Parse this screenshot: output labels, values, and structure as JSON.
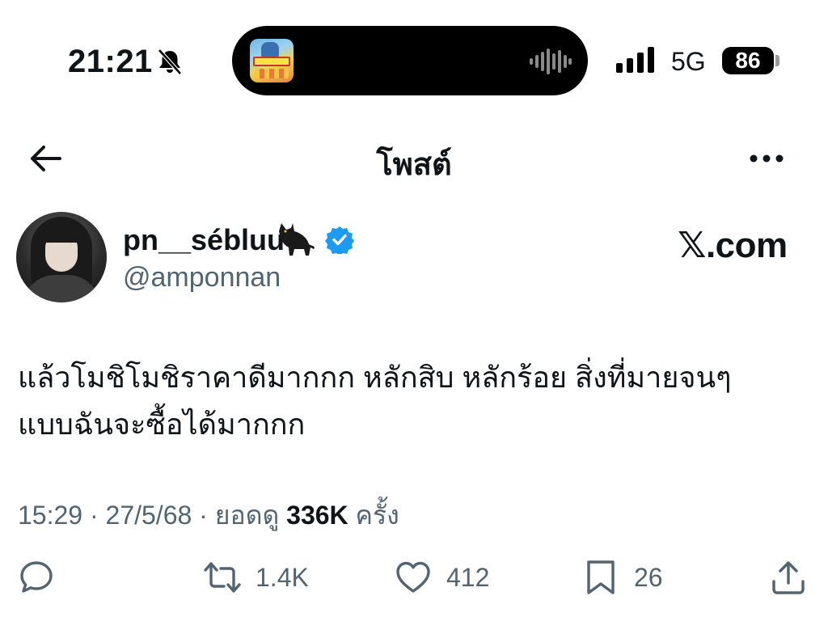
{
  "status_bar": {
    "time": "21:21",
    "network": "5G",
    "battery": "86"
  },
  "header": {
    "title": "โพสต์"
  },
  "author": {
    "display_name": "pn__sébluu",
    "handle": "@amponnan",
    "badge_icon": "verified-badge-icon",
    "badge_color": "#1d9bf0"
  },
  "watermark": "𝕏.com",
  "tweet": {
    "text": "แล้วโมชิโมชิราคาดีมากกก หลักสิบ หลักร้อย สิ่งที่มายจนๆ\nแบบฉันจะซื้อได้มากกก"
  },
  "meta": {
    "time": "15:29",
    "date": "27/5/68",
    "views_label": "ยอดดู",
    "views_count": "336K",
    "views_suffix": "ครั้ง"
  },
  "actions": {
    "reply": {
      "icon": "reply-icon",
      "count": ""
    },
    "retweet": {
      "icon": "retweet-icon",
      "count": "1.4K"
    },
    "like": {
      "icon": "heart-icon",
      "count": "412"
    },
    "bookmark": {
      "icon": "bookmark-icon",
      "count": "26"
    },
    "share": {
      "icon": "share-icon",
      "count": ""
    }
  }
}
